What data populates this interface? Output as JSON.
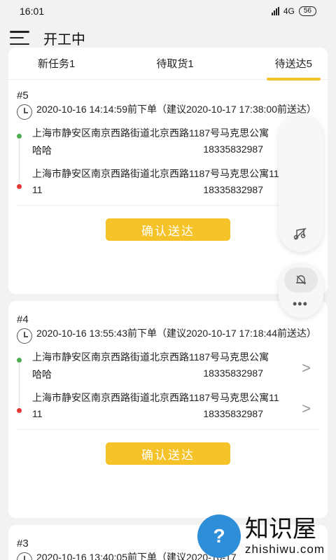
{
  "status_bar": {
    "time": "16:01",
    "network": "4G",
    "battery": "56"
  },
  "header": {
    "title": "开工中"
  },
  "tabs": [
    {
      "label": "新任务1",
      "active": false
    },
    {
      "label": "待取货1",
      "active": false
    },
    {
      "label": "待送达5",
      "active": true
    }
  ],
  "orders": [
    {
      "number": "#5",
      "time": "2020-10-16 14:14:59前下单（建议2020-10-17 17:38:00前送达）",
      "pickup": {
        "address": "上海市静安区南京西路街道北京西路1187号马克思公寓",
        "name": "哈哈",
        "phone": "18335832987"
      },
      "dropoff": {
        "address": "上海市静安区南京西路街道北京西路1187号马克思公寓11",
        "name": "11",
        "phone": "18335832987"
      },
      "button": "确认送达"
    },
    {
      "number": "#4",
      "time": "2020-10-16 13:55:43前下单（建议2020-10-17 17:18:44前送达）",
      "pickup": {
        "address": "上海市静安区南京西路街道北京西路1187号马克思公寓",
        "name": "哈哈",
        "phone": "18335832987"
      },
      "dropoff": {
        "address": "上海市静安区南京西路街道北京西路1187号马克思公寓11",
        "name": "11",
        "phone": "18335832987"
      },
      "button": "确认送达"
    },
    {
      "number": "#3",
      "time": "2020-10-16 13:40:05前下单（建议2020-10-17"
    }
  ],
  "watermark": {
    "cn": "知识屋",
    "en": "zhishiwu.com"
  },
  "colors": {
    "accent": "#f5c227",
    "green_dot": "#4caf50",
    "red_dot": "#e53935"
  }
}
